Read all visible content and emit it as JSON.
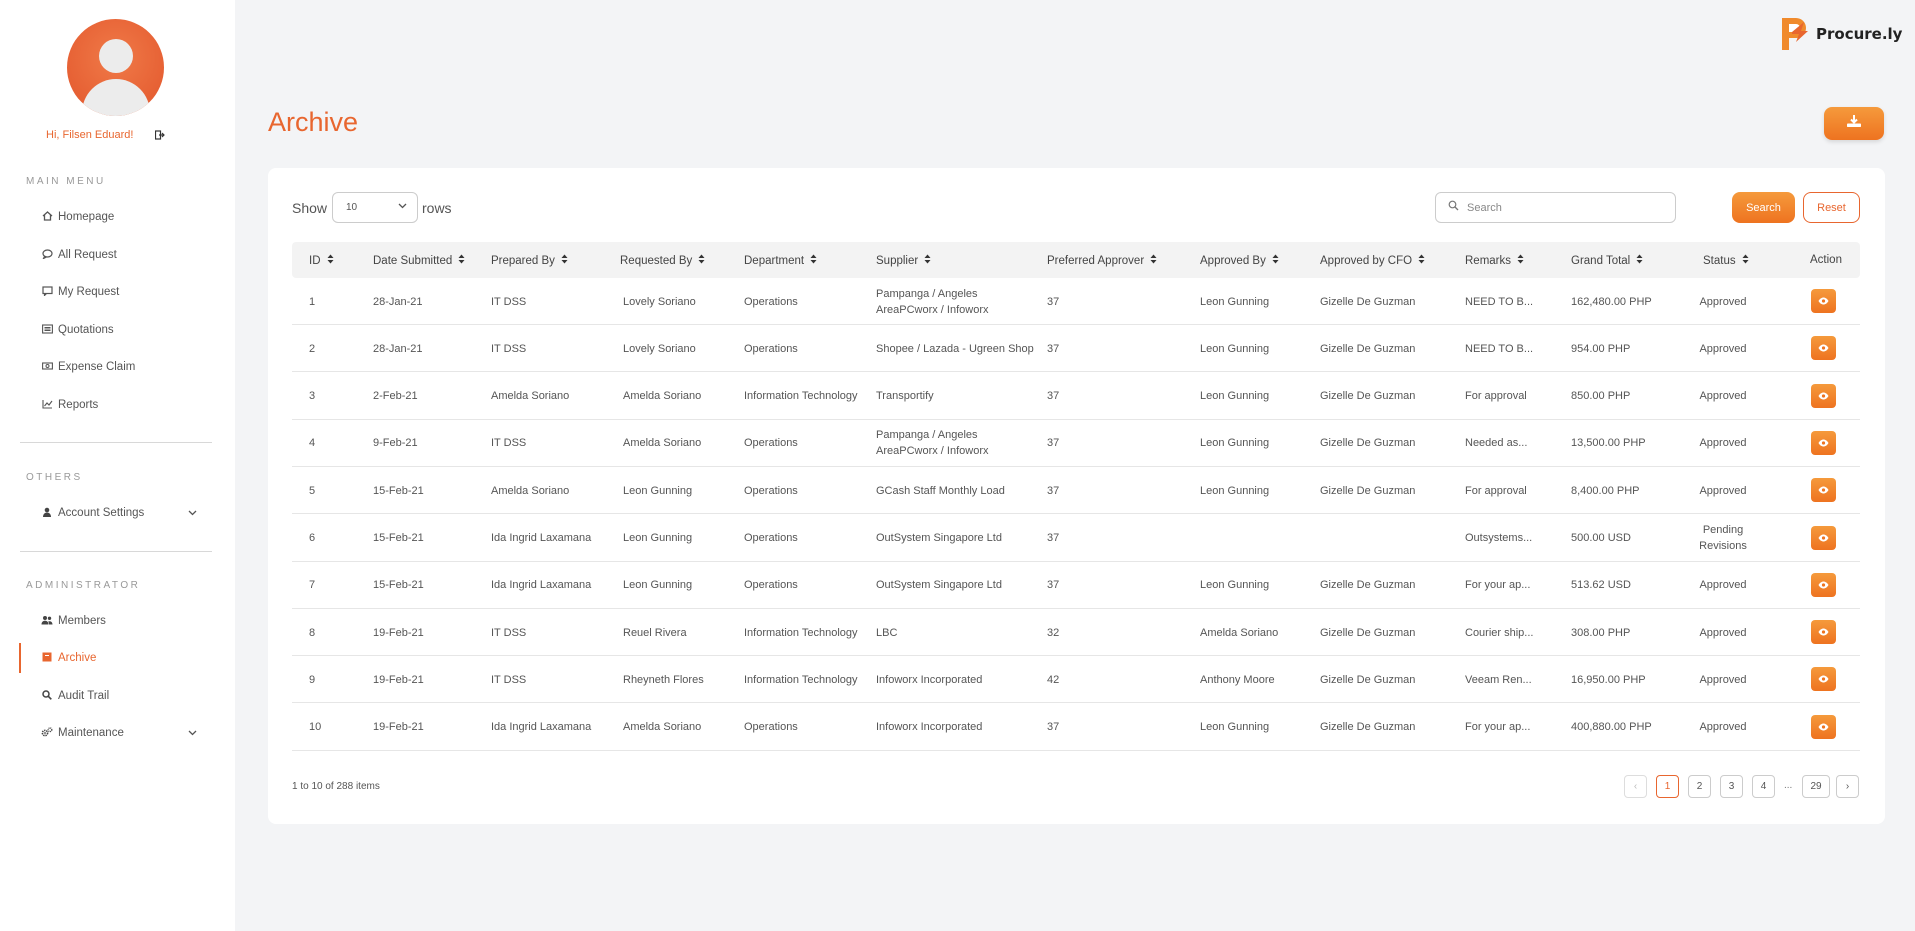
{
  "app": {
    "name": "Procure.ly",
    "accent": "#e8662f"
  },
  "user": {
    "greeting": "Hi, Filsen Eduard!"
  },
  "sidebar": {
    "main_menu_title": "MAIN MENU",
    "main_menu": [
      {
        "label": "Homepage",
        "icon": "home-icon"
      },
      {
        "label": "All Request",
        "icon": "chat-icon"
      },
      {
        "label": "My Request",
        "icon": "comment-icon"
      },
      {
        "label": "Quotations",
        "icon": "list-icon"
      },
      {
        "label": "Expense Claim",
        "icon": "money-icon"
      },
      {
        "label": "Reports",
        "icon": "chart-line-icon"
      }
    ],
    "others_title": "OTHERS",
    "others": [
      {
        "label": "Account Settings",
        "icon": "user-icon"
      }
    ],
    "admin_title": "ADMINISTRATOR",
    "admin": [
      {
        "label": "Members",
        "icon": "users-icon"
      },
      {
        "label": "Archive",
        "icon": "archive-icon",
        "active": true
      },
      {
        "label": "Audit Trail",
        "icon": "search-icon"
      },
      {
        "label": "Maintenance",
        "icon": "cogs-icon"
      }
    ]
  },
  "page": {
    "title": "Archive"
  },
  "controls": {
    "show_label": "Show",
    "rows_value": "10",
    "rows_label": "rows",
    "search_placeholder": "Search",
    "search_button": "Search",
    "reset_button": "Reset"
  },
  "table": {
    "columns": [
      "ID",
      "Date Submitted",
      "Prepared By",
      "Requested By",
      "Department",
      "Supplier",
      "Preferred Approver",
      "Approved By",
      "Approved by CFO",
      "Remarks",
      "Grand Total",
      "Status",
      "Action"
    ],
    "rows": [
      {
        "id": "1",
        "date": "28-Jan-21",
        "prepared": "IT DSS",
        "requested": "Lovely Soriano",
        "dept": "Operations",
        "supplier": "Pampanga / Angeles AreaPCworx / Infoworx",
        "pref": "37",
        "approved": "Leon Gunning",
        "cfo": "Gizelle De Guzman",
        "remarks": "NEED TO B...",
        "total": "162,480.00 PHP",
        "status": "Approved"
      },
      {
        "id": "2",
        "date": "28-Jan-21",
        "prepared": "IT DSS",
        "requested": "Lovely Soriano",
        "dept": "Operations",
        "supplier": "Shopee / Lazada - Ugreen Shop",
        "pref": "37",
        "approved": "Leon Gunning",
        "cfo": "Gizelle De Guzman",
        "remarks": "NEED TO B...",
        "total": "954.00 PHP",
        "status": "Approved"
      },
      {
        "id": "3",
        "date": "2-Feb-21",
        "prepared": "Amelda Soriano",
        "requested": "Amelda Soriano",
        "dept": "Information Technology",
        "supplier": "Transportify",
        "pref": "37",
        "approved": "Leon Gunning",
        "cfo": "Gizelle De Guzman",
        "remarks": "For approval",
        "total": "850.00 PHP",
        "status": "Approved"
      },
      {
        "id": "4",
        "date": "9-Feb-21",
        "prepared": "IT DSS",
        "requested": "Amelda Soriano",
        "dept": "Operations",
        "supplier": "Pampanga / Angeles AreaPCworx / Infoworx",
        "pref": "37",
        "approved": "Leon Gunning",
        "cfo": "Gizelle De Guzman",
        "remarks": "Needed as...",
        "total": "13,500.00 PHP",
        "status": "Approved"
      },
      {
        "id": "5",
        "date": "15-Feb-21",
        "prepared": "Amelda Soriano",
        "requested": "Leon Gunning",
        "dept": "Operations",
        "supplier": "GCash Staff Monthly Load",
        "pref": "37",
        "approved": "Leon Gunning",
        "cfo": "Gizelle De Guzman",
        "remarks": "For approval",
        "total": "8,400.00 PHP",
        "status": "Approved"
      },
      {
        "id": "6",
        "date": "15-Feb-21",
        "prepared": "Ida Ingrid Laxamana",
        "requested": "Leon Gunning",
        "dept": "Operations",
        "supplier": "OutSystem Singapore Ltd",
        "pref": "37",
        "approved": "",
        "cfo": "",
        "remarks": "Outsystems...",
        "total": "500.00 USD",
        "status": "Pending Revisions"
      },
      {
        "id": "7",
        "date": "15-Feb-21",
        "prepared": "Ida Ingrid Laxamana",
        "requested": "Leon Gunning",
        "dept": "Operations",
        "supplier": "OutSystem Singapore Ltd",
        "pref": "37",
        "approved": "Leon Gunning",
        "cfo": "Gizelle De Guzman",
        "remarks": "For your ap...",
        "total": "513.62 USD",
        "status": "Approved"
      },
      {
        "id": "8",
        "date": "19-Feb-21",
        "prepared": "IT DSS",
        "requested": "Reuel Rivera",
        "dept": "Information Technology",
        "supplier": "LBC",
        "pref": "32",
        "approved": "Amelda Soriano",
        "cfo": "Gizelle De Guzman",
        "remarks": "Courier ship...",
        "total": "308.00 PHP",
        "status": "Approved"
      },
      {
        "id": "9",
        "date": "19-Feb-21",
        "prepared": "IT DSS",
        "requested": "Rheyneth Flores",
        "dept": "Information Technology",
        "supplier": "Infoworx Incorporated",
        "pref": "42",
        "approved": "Anthony Moore",
        "cfo": "Gizelle De Guzman",
        "remarks": "Veeam Ren...",
        "total": "16,950.00 PHP",
        "status": "Approved"
      },
      {
        "id": "10",
        "date": "19-Feb-21",
        "prepared": "Ida Ingrid Laxamana",
        "requested": "Amelda Soriano",
        "dept": "Operations",
        "supplier": "Infoworx Incorporated",
        "pref": "37",
        "approved": "Leon Gunning",
        "cfo": "Gizelle De Guzman",
        "remarks": "For your ap...",
        "total": "400,880.00 PHP",
        "status": "Approved"
      }
    ]
  },
  "pagination": {
    "summary": "1 to 10 of 288 items",
    "prev": "‹",
    "pages": [
      "1",
      "2",
      "3",
      "4"
    ],
    "ellipsis": "...",
    "last": "29",
    "next": "›"
  }
}
